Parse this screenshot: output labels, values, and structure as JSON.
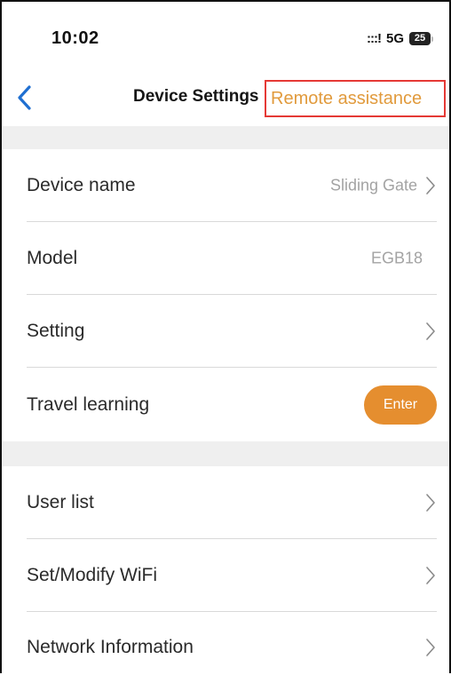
{
  "status_bar": {
    "time": "10:02",
    "signal": ":::!",
    "network": "5G",
    "battery": "25"
  },
  "nav": {
    "back_icon": "chevron-left-icon",
    "title": "Device Settings",
    "remote_assistance": "Remote assistance"
  },
  "colors": {
    "accent_orange": "#e58e2f",
    "remote_text": "#e19a3c",
    "highlight_red": "#e53935",
    "back_blue": "#1f6fd1",
    "section_gap": "#efefef"
  },
  "settings": {
    "device_name": {
      "label": "Device name",
      "value": "Sliding Gate"
    },
    "model": {
      "label": "Model",
      "value": "EGB18"
    },
    "setting": {
      "label": "Setting"
    },
    "travel_learning": {
      "label": "Travel learning",
      "button": "Enter"
    },
    "user_list": {
      "label": "User list"
    },
    "wifi": {
      "label": "Set/Modify WiFi"
    },
    "network_info": {
      "label": "Network Information"
    }
  }
}
